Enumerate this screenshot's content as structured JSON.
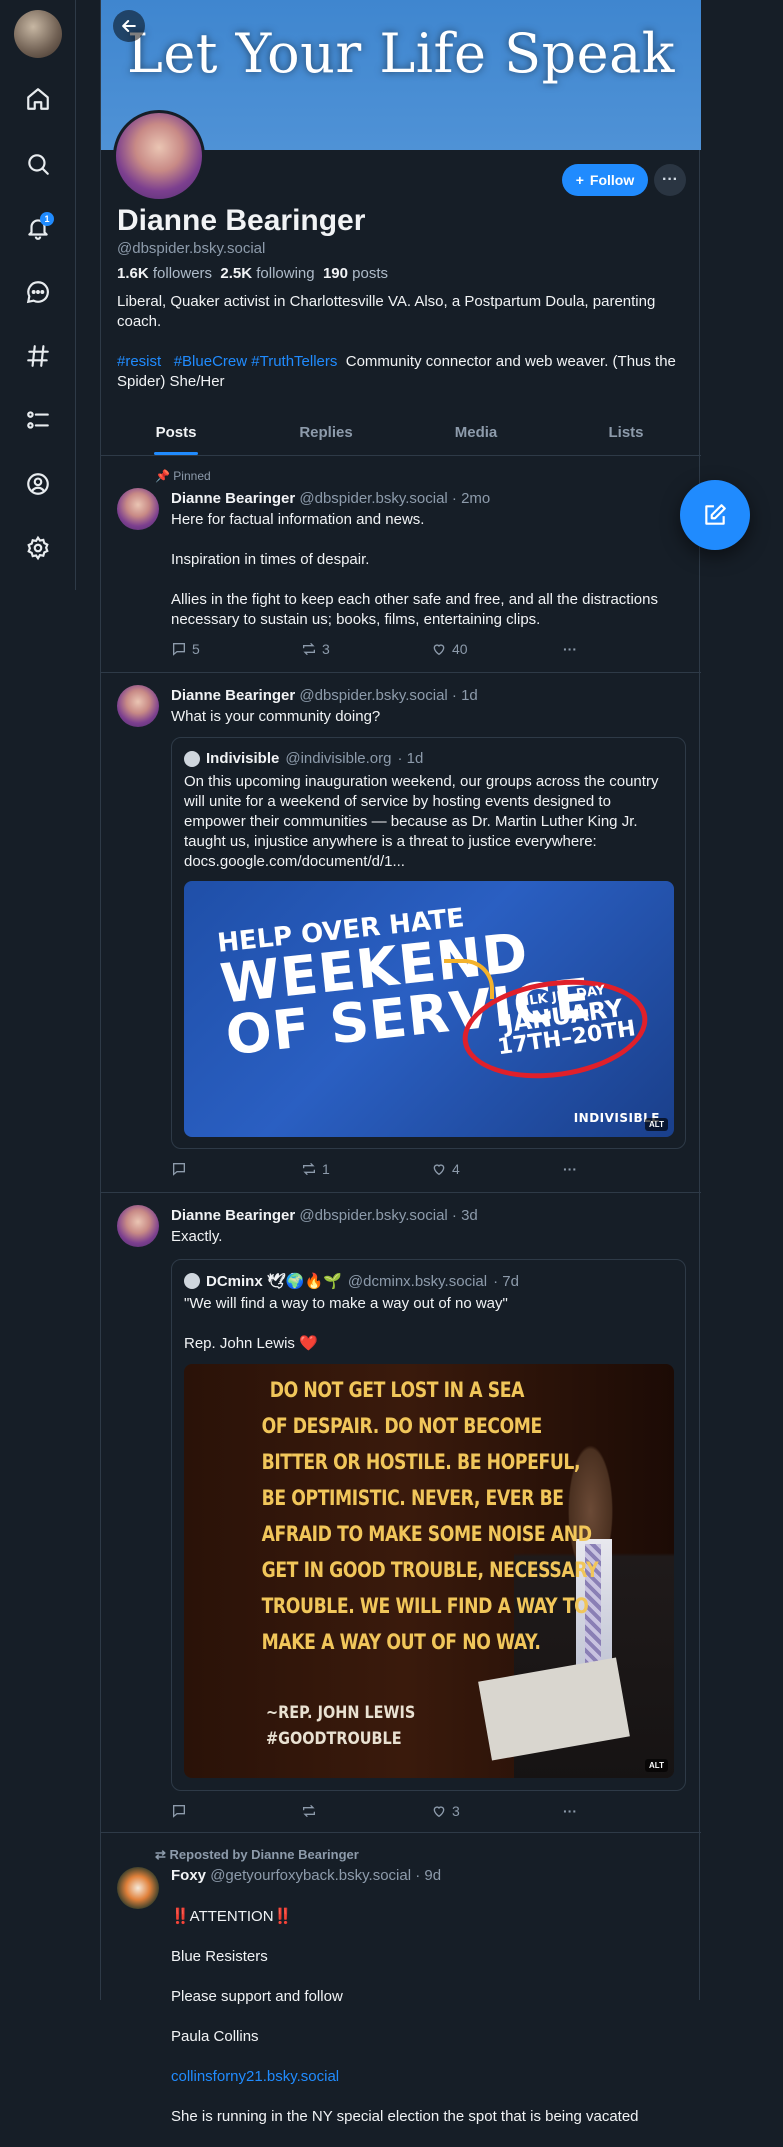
{
  "sidebar": {
    "notifications_badge": "1"
  },
  "profile": {
    "banner_text": "Let Your Life Speak",
    "display_name": "Dianne Bearinger",
    "handle": "@dbspider.bsky.social",
    "followers_count": "1.6K",
    "followers_label": "followers",
    "following_count": "2.5K",
    "following_label": "following",
    "posts_count": "190",
    "posts_label": "posts",
    "bio_line1": "Liberal, Quaker activist in Charlottesville VA. Also, a Postpartum Doula, parenting coach.",
    "bio_tag1": "#resist",
    "bio_tag2": "#BlueCrew",
    "bio_tag3": "#TruthTellers",
    "bio_line2": "Community connector and web weaver. (Thus the Spider) She/Her",
    "follow_label": "Follow",
    "more_label": "···"
  },
  "tabs": [
    "Posts",
    "Replies",
    "Media",
    "Lists"
  ],
  "posts": [
    {
      "pinned_label": "Pinned",
      "author": "Dianne Bearinger",
      "handle": "@dbspider.bsky.social",
      "time": "· 2mo",
      "text": "Here for factual information and news.\n\nInspiration in times of despair.\n\nAllies in the fight to keep each other safe and free, and all the distractions necessary to sustain us; books, films, entertaining clips.",
      "replies": "5",
      "reposts": "3",
      "likes": "40"
    },
    {
      "author": "Dianne Bearinger",
      "handle": "@dbspider.bsky.social",
      "time": "· 1d",
      "text": "What is your community doing?",
      "replies": "",
      "reposts": "1",
      "likes": "4",
      "quote": {
        "author": "Indivisible",
        "handle": "@indivisible.org",
        "time": "· 1d",
        "text": "On this upcoming inauguration weekend, our groups across the country will unite for a weekend of service by hosting events designed to empower their communities — because as Dr. Martin Luther King Jr. taught us, injustice anywhere is a threat to justice everywhere: docs.google.com/document/d/1...",
        "image": {
          "line1": "HELP OVER HATE",
          "line2": "WEEKEND",
          "line3": "OF SERVICE",
          "mlk1": "MLK JR. DAY",
          "mlk2": "JANUARY",
          "mlk3": "17TH–20TH",
          "brand": "INDIVISIBLE",
          "alt": "ALT"
        }
      }
    },
    {
      "author": "Dianne Bearinger",
      "handle": "@dbspider.bsky.social",
      "time": "· 3d",
      "text": "Exactly.",
      "replies": "",
      "reposts": "",
      "likes": "3",
      "quote": {
        "author": "DCminx 🕊🌍🔥🌱",
        "handle": "@dcminx.bsky.social",
        "time": "· 7d",
        "text": "\"We will find a way to make a way out of no way\"\n\nRep. John Lewis ❤️",
        "image": {
          "lines": [
            "DO NOT GET LOST IN A SEA",
            "OF DESPAIR. DO NOT BECOME",
            "BITTER OR HOSTILE. BE HOPEFUL,",
            "BE OPTIMISTIC. NEVER, EVER BE",
            "AFRAID TO MAKE SOME NOISE AND",
            "GET IN GOOD TROUBLE, NECESSARY",
            "TROUBLE. WE WILL FIND A WAY TO",
            "MAKE A WAY OUT OF NO WAY."
          ],
          "attr1": "~REP. JOHN LEWIS",
          "attr2": "#GOODTROUBLE",
          "alt": "ALT"
        }
      }
    },
    {
      "reposted_label": "Reposted by Dianne Bearinger",
      "author": "Foxy",
      "handle": "@getyourfoxyback.bsky.social",
      "time": "· 9d",
      "text_lines": [
        "‼️ATTENTION‼️",
        "Blue Resisters",
        "Please support and follow",
        "Paula Collins"
      ],
      "link": "collinsforny21.bsky.social",
      "text_tail": "She is running in the NY special election the spot that is being vacated"
    }
  ]
}
